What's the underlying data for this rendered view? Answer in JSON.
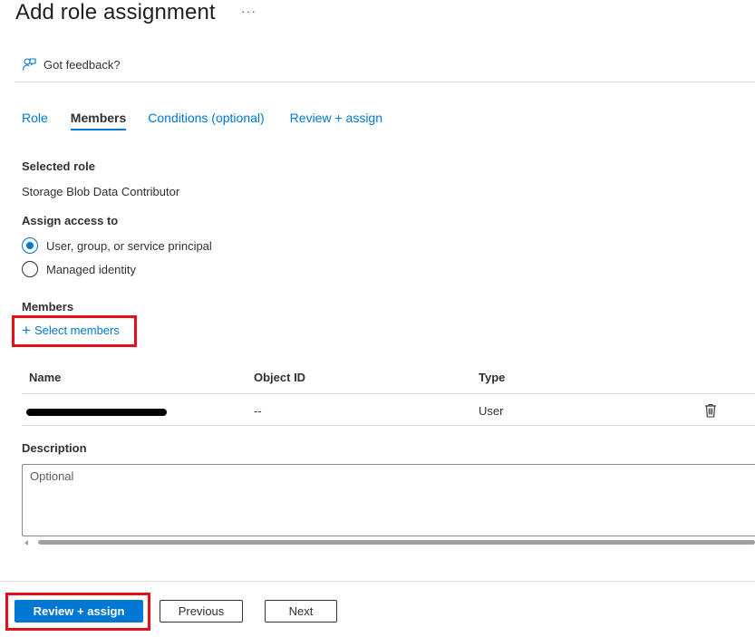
{
  "header": {
    "title": "Add role assignment",
    "more_label": "···"
  },
  "feedback": {
    "label": "Got feedback?"
  },
  "tabs": [
    {
      "label": "Role",
      "active": false
    },
    {
      "label": "Members",
      "active": true
    },
    {
      "label": "Conditions (optional)",
      "active": false
    },
    {
      "label": "Review + assign",
      "active": false
    }
  ],
  "selected_role": {
    "label": "Selected role",
    "value": "Storage Blob Data Contributor"
  },
  "assign_access": {
    "label": "Assign access to",
    "options": [
      {
        "label": "User, group, or service principal",
        "checked": true
      },
      {
        "label": "Managed identity",
        "checked": false
      }
    ]
  },
  "members": {
    "label": "Members",
    "select_label": "Select members",
    "columns": [
      "Name",
      "Object ID",
      "Type"
    ],
    "rows": [
      {
        "name": "",
        "object_id": "--",
        "type": "User"
      }
    ]
  },
  "description": {
    "label": "Description",
    "placeholder": "Optional"
  },
  "footer": {
    "review_assign": "Review + assign",
    "previous": "Previous",
    "next": "Next"
  },
  "colors": {
    "accent": "#0078d4",
    "highlight": "#e3101a"
  }
}
